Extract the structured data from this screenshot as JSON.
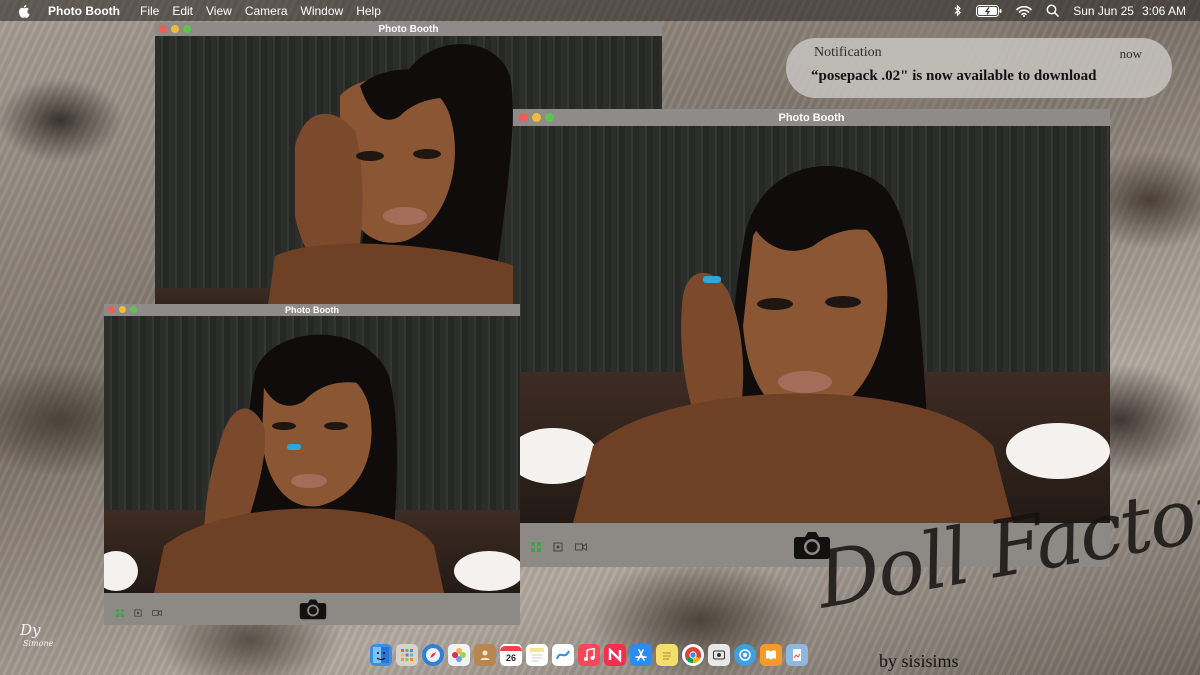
{
  "menubar": {
    "app_name": "Photo Booth",
    "menus": [
      "File",
      "Edit",
      "View",
      "Camera",
      "Window",
      "Help"
    ],
    "date": "Sun Jun 25",
    "time": "3:06 AM"
  },
  "windows": {
    "top_left": {
      "title": "Photo Booth"
    },
    "bottom_left": {
      "title": "Photo Booth"
    },
    "main": {
      "title": "Photo Booth"
    }
  },
  "notification": {
    "title": "Notification",
    "time": "now",
    "message": "“posepack .02\" is now available to download"
  },
  "watermark": {
    "brand": "Doll Factory",
    "byline": "by sisisims",
    "signature": "Dy",
    "signature_sub": "Simone"
  },
  "dock": {
    "calendar_day": "26",
    "items": [
      {
        "icon": "finder-icon",
        "color": "#3a8ee6"
      },
      {
        "icon": "launchpad-icon",
        "color": "#d9d2ca"
      },
      {
        "icon": "safari-icon",
        "color": "#2f7ed8"
      },
      {
        "icon": "photos-icon",
        "color": "#f2f2f2"
      },
      {
        "icon": "contacts-icon",
        "color": "#b8864e"
      },
      {
        "icon": "calendar-icon",
        "color": "#ffffff"
      },
      {
        "icon": "notes-icon",
        "color": "#f7e68a"
      },
      {
        "icon": "freeform-icon",
        "color": "#ffffff"
      },
      {
        "icon": "music-icon",
        "color": "#fa4659"
      },
      {
        "icon": "news-icon",
        "color": "#f0314d"
      },
      {
        "icon": "app-store-icon",
        "color": "#2a8cf0"
      },
      {
        "icon": "stickies-icon",
        "color": "#f3de6b"
      },
      {
        "icon": "chrome-icon",
        "color": "#ffffff"
      },
      {
        "icon": "screenshot-icon",
        "color": "#e8e8e8"
      },
      {
        "icon": "system-icon",
        "color": "#3da0e0"
      },
      {
        "icon": "books-icon",
        "color": "#f39a2a"
      },
      {
        "icon": "preview-icon",
        "color": "#8fb8e0"
      }
    ]
  },
  "colors": {
    "close": "#ec5f57",
    "minimize": "#f0bd3b",
    "zoom": "#5bc550"
  }
}
